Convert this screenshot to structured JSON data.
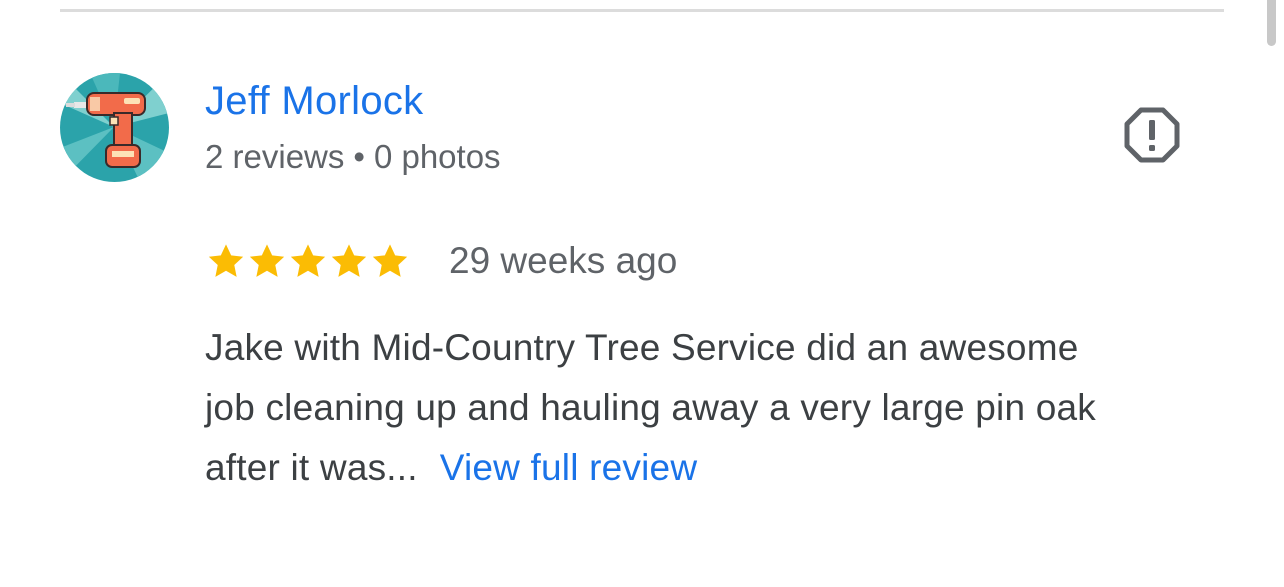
{
  "reviewer": {
    "name": "Jeff Morlock",
    "reviews_count": "2 reviews",
    "separator": "•",
    "photos_count": "0 photos",
    "avatar_icon": "power-drill-icon"
  },
  "review": {
    "rating": 5,
    "rating_max": 5,
    "date": "29 weeks ago",
    "text_lines": [
      "Jake with Mid-Country Tree Service did an awesome",
      "job cleaning up and hauling away a very large pin oak",
      "after it was..."
    ],
    "view_full_label": "View full review"
  },
  "actions": {
    "report_icon": "report-flag-octagon-icon"
  },
  "colors": {
    "link": "#1a73e8",
    "star": "#fbbc04",
    "meta_text": "#5f6368",
    "body_text": "#3c4043",
    "avatar_bg": "#29a3a9",
    "avatar_drill": "#f26b4a"
  }
}
